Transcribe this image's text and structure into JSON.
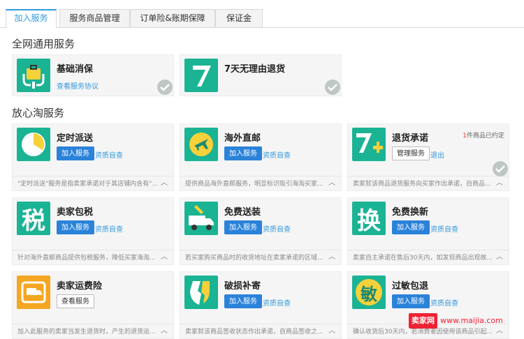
{
  "tabs": [
    {
      "label": "加入服务"
    },
    {
      "label": "服务商品管理"
    },
    {
      "label": "订单险&账期保障"
    },
    {
      "label": "保证金"
    }
  ],
  "sections": {
    "general": "全网通用服务",
    "assured": "放心淘服务"
  },
  "cards": {
    "jichuxiaobao": {
      "name": "基础消保",
      "link": "查看服务协议",
      "icon": "shield-bag-icon",
      "color": "#1ab394"
    },
    "qitian": {
      "name": "7天无理由退货",
      "icon": "seven-icon",
      "color": "#1ab394"
    },
    "dingshi": {
      "name": "定时派送",
      "btn": "加入服务",
      "link": "资质自查",
      "desc": "\"定时派送\"服务是指卖家承诺对于其店铺内含有\"...",
      "icon": "clock-icon",
      "color": "#1ab394"
    },
    "haiwai": {
      "name": "海外直邮",
      "btn": "加入服务",
      "link": "资质自查",
      "desc": "提供商品海外直邮服务，明显标识吸引海淘买家...",
      "icon": "plane-icon",
      "color": "#1ab394"
    },
    "tuihuo": {
      "name": "退货承诺",
      "btn": "管理服务",
      "link": "退出",
      "note_num": "1",
      "note_text": "件商品已约定",
      "desc": "卖家就该商品退货服务向买家作出承诺，自商品...",
      "icon": "seven-plus-icon",
      "color": "#1ab394"
    },
    "baoshui": {
      "name": "卖家包税",
      "btn": "加入服务",
      "link": "资质自查",
      "desc": "针对海外直邮商品提供包税服务，降低买家海淘...",
      "icon": "tax-icon",
      "glyph": "税",
      "color": "#1ab394"
    },
    "songzhuang": {
      "name": "免费送装",
      "btn": "加入服务",
      "link": "资质自查",
      "desc": "若买家购买商品时的收货地址在卖家承诺的区域...",
      "icon": "truck-wrench-icon",
      "color": "#1ab394"
    },
    "huanxin": {
      "name": "免费换新",
      "btn": "加入服务",
      "link": "资质自查",
      "desc": "卖家自主承诺在售后30天内，如发现商品出现故...",
      "icon": "exchange-icon",
      "glyph": "换",
      "color": "#1ab394"
    },
    "yunfeixian": {
      "name": "卖家运费险",
      "btn": "查看服务",
      "desc": "加入此服务的卖家当发生退货时，产生的退货运...",
      "icon": "shipping-truck-icon",
      "color": "#f5a623"
    },
    "posun": {
      "name": "破损补寄",
      "btn": "加入服务",
      "link": "资质自查",
      "desc": "卖家就该商品签收状态作出承诺，自商品签收之...",
      "icon": "broken-shield-icon",
      "color": "#1ab394"
    },
    "guomin": {
      "name": "过敏包退",
      "btn": "加入服务",
      "link": "资质自查",
      "desc": "确认收货后30天内，若消费者因使用该商品引起...",
      "icon": "allergy-icon",
      "glyph": "敏",
      "color": "#1ab394"
    }
  },
  "watermark": {
    "badge": "卖家网",
    "url": "www.maijia.com"
  }
}
